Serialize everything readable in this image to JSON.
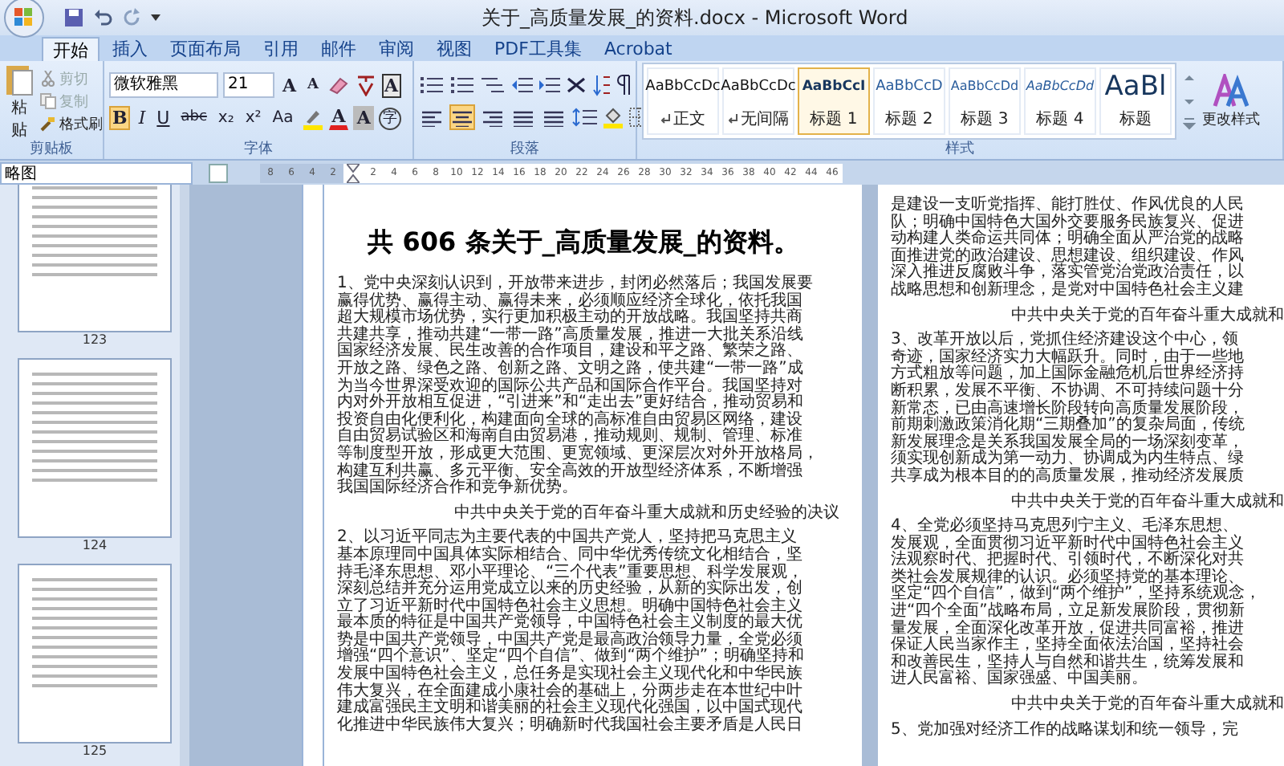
{
  "window": {
    "title": "关于_高质量发展_的资料.docx - Microsoft Word"
  },
  "ribbon_tabs": [
    {
      "label": "开始",
      "selected": true
    },
    {
      "label": "插入",
      "selected": false
    },
    {
      "label": "页面布局",
      "selected": false
    },
    {
      "label": "引用",
      "selected": false
    },
    {
      "label": "邮件",
      "selected": false
    },
    {
      "label": "审阅",
      "selected": false
    },
    {
      "label": "视图",
      "selected": false
    },
    {
      "label": "PDF工具集",
      "selected": false
    },
    {
      "label": "Acrobat",
      "selected": false
    }
  ],
  "clipboard": {
    "label": "剪贴板",
    "paste": "粘贴",
    "tools": [
      {
        "kind": "cut",
        "label": "剪切",
        "disabled": true
      },
      {
        "kind": "copy",
        "label": "复制",
        "disabled": true
      },
      {
        "kind": "painter",
        "label": "格式刷",
        "disabled": false
      }
    ]
  },
  "font": {
    "label": "字体",
    "family": "微软雅黑",
    "size": "21",
    "grow": "A",
    "shrink": "A",
    "border_char": "A",
    "format_buttons": [
      {
        "label": "B",
        "selected": true
      },
      {
        "label": "I",
        "selected": false
      },
      {
        "label": "U",
        "selected": false
      },
      {
        "label": "abc",
        "selected": false
      },
      {
        "label": "x₂",
        "selected": false
      },
      {
        "label": "x²",
        "selected": false
      },
      {
        "label": "Aa",
        "selected": false
      }
    ],
    "color_buttons": [
      {
        "kind": "highlight"
      },
      {
        "kind": "font_color",
        "label": "A"
      },
      {
        "kind": "shading",
        "label": "A"
      },
      {
        "kind": "enclosed",
        "label": "字"
      }
    ]
  },
  "paragraph": {
    "label": "段落",
    "align_buttons": [
      {
        "kind": "left",
        "selected": false
      },
      {
        "kind": "center",
        "selected": true
      },
      {
        "kind": "right",
        "selected": false
      },
      {
        "kind": "justify",
        "selected": false
      },
      {
        "kind": "distributed",
        "selected": false
      }
    ]
  },
  "styles": {
    "label": "样式",
    "change_styles": "更改样式",
    "items": [
      {
        "kind": "normal",
        "preview": "AaBbCcDc",
        "name": "正文",
        "paragraph_mark": true,
        "selected": false
      },
      {
        "kind": "normal",
        "preview": "AaBbCcDc",
        "name": "无间隔",
        "paragraph_mark": true,
        "selected": false
      },
      {
        "kind": "heading1",
        "preview": "AaBbCcI",
        "name": "标题 1",
        "paragraph_mark": false,
        "selected": true
      },
      {
        "kind": "heading2",
        "preview": "AaBbCcD",
        "name": "标题 2",
        "paragraph_mark": false,
        "selected": false
      },
      {
        "kind": "heading3",
        "preview": "AaBbCcDd",
        "name": "标题 3",
        "paragraph_mark": false,
        "selected": false
      },
      {
        "kind": "heading4",
        "preview": "AaBbCcDd",
        "name": "标题 4",
        "paragraph_mark": false,
        "selected": false
      },
      {
        "kind": "title",
        "preview": "AaBl",
        "name": "标题",
        "paragraph_mark": false,
        "selected": false
      }
    ]
  },
  "navigation": {
    "title": "略图",
    "pages": [
      {
        "number": "123"
      },
      {
        "number": "124"
      },
      {
        "number": "125"
      }
    ]
  },
  "ruler": {
    "left_ticks": [
      "8",
      "6",
      "4",
      "2"
    ],
    "ticks": [
      "2",
      "4",
      "6",
      "8",
      "10",
      "12",
      "14",
      "16",
      "18",
      "20",
      "22",
      "24",
      "26",
      "28",
      "30",
      "32",
      "34",
      "36",
      "38",
      "40",
      "42",
      "44",
      "46"
    ]
  },
  "document": {
    "pages": [
      {
        "title": "共 606 条关于_高质量发展_的资料。",
        "blocks": [
          {
            "kind": "paragraph",
            "lines": [
              "1、党中央深刻认识到，开放带来进步，封闭必然落后；我国发展要",
              "赢得优势、赢得主动、赢得未来，必须顺应经济全球化，依托我国",
              "超大规模市场优势，实行更加积极主动的开放战略。我国坚持共商",
              "共建共享，推动共建“一带一路”高质量发展，推进一大批关系沿线",
              "国家经济发展、民生改善的合作项目，建设和平之路、繁荣之路、",
              "开放之路、绿色之路、创新之路、文明之路，使共建“一带一路”成",
              "为当今世界深受欢迎的国际公共产品和国际合作平台。我国坚持对",
              "内对外开放相互促进，“引进来”和“走出去”更好结合，推动贸易和",
              "投资自由化便利化，构建面向全球的高标准自由贸易区网络，建设",
              "自由贸易试验区和海南自由贸易港，推动规则、规制、管理、标准",
              "等制度型开放，形成更大范围、更宽领域、更深层次对外开放格局，",
              "构建互利共赢、多元平衡、安全高效的开放型经济体系，不断增强",
              "我国国际经济合作和竞争新优势。"
            ]
          },
          {
            "kind": "source",
            "text": "中共中央关于党的百年奋斗重大成就和历史经验的决议"
          },
          {
            "kind": "paragraph",
            "lines": [
              "2、以习近平同志为主要代表的中国共产党人，坚持把马克思主义",
              "基本原理同中国具体实际相结合、同中华优秀传统文化相结合，坚",
              "持毛泽东思想、邓小平理论、“三个代表”重要思想、科学发展观，",
              "深刻总结并充分运用党成立以来的历史经验，从新的实际出发，创",
              "立了习近平新时代中国特色社会主义思想。明确中国特色社会主义",
              "最本质的特征是中国共产党领导，中国特色社会主义制度的最大优",
              "势是中国共产党领导，中国共产党是最高政治领导力量，全党必须",
              "增强“四个意识”、坚定“四个自信”、做到“两个维护”；明确坚持和",
              "发展中国特色社会主义，总任务是实现社会主义现代化和中华民族",
              "伟大复兴，在全面建成小康社会的基础上，分两步走在本世纪中叶",
              "建成富强民主文明和谐美丽的社会主义现代化强国，以中国式现代",
              "化推进中华民族伟大复兴；明确新时代我国社会主要矛盾是人民日"
            ]
          }
        ]
      },
      {
        "blocks": [
          {
            "kind": "paragraph",
            "lines": [
              "是建设一支听党指挥、能打胜仗、作风优良的人民",
              "队；明确中国特色大国外交要服务民族复兴、促进",
              "动构建人类命运共同体；明确全面从严治党的战略",
              "面推进党的政治建设、思想建设、组织建设、作风",
              "深入推进反腐败斗争，落实管党治党政治责任，以",
              "战略思想和创新理念，是党对中国特色社会主义建"
            ]
          },
          {
            "kind": "source",
            "text": "中共中央关于党的百年奋斗重大成就和"
          },
          {
            "kind": "paragraph",
            "lines": [
              "3、改革开放以后，党抓住经济建设这个中心，领",
              "奇迹，国家经济实力大幅跃升。同时，由于一些地",
              "方式粗放等问题，加上国际金融危机后世界经济持",
              "断积累，发展不平衡、不协调、不可持续问题十分",
              "新常态，已由高速增长阶段转向高质量发展阶段，",
              "前期刺激政策消化期“三期叠加”的复杂局面，传统",
              "新发展理念是关系我国发展全局的一场深刻变革，",
              "须实现创新成为第一动力、协调成为内生特点、绿",
              "共享成为根本目的的高质量发展，推动经济发展质"
            ]
          },
          {
            "kind": "source",
            "text": "中共中央关于党的百年奋斗重大成就和"
          },
          {
            "kind": "paragraph",
            "lines": [
              "4、全党必须坚持马克思列宁主义、毛泽东思想、",
              "发展观，全面贯彻习近平新时代中国特色社会主义",
              "法观察时代、把握时代、引领时代，不断深化对共",
              "类社会发展规律的认识。必须坚持党的基本理论、",
              "坚定“四个自信”，做到“两个维护”，坚持系统观念，",
              "进“四个全面”战略布局，立足新发展阶段，贯彻新",
              "量发展，全面深化改革开放，促进共同富裕，推进",
              "保证人民当家作主，坚持全面依法治国，坚持社会",
              "和改善民生，坚持人与自然和谐共生，统筹发展和",
              "进人民富裕、国家强盛、中国美丽。"
            ]
          },
          {
            "kind": "source",
            "text": "中共中央关于党的百年奋斗重大成就和"
          },
          {
            "kind": "paragraph",
            "lines": [
              "5、党加强对经济工作的战略谋划和统一领导，完"
            ]
          }
        ]
      }
    ]
  }
}
